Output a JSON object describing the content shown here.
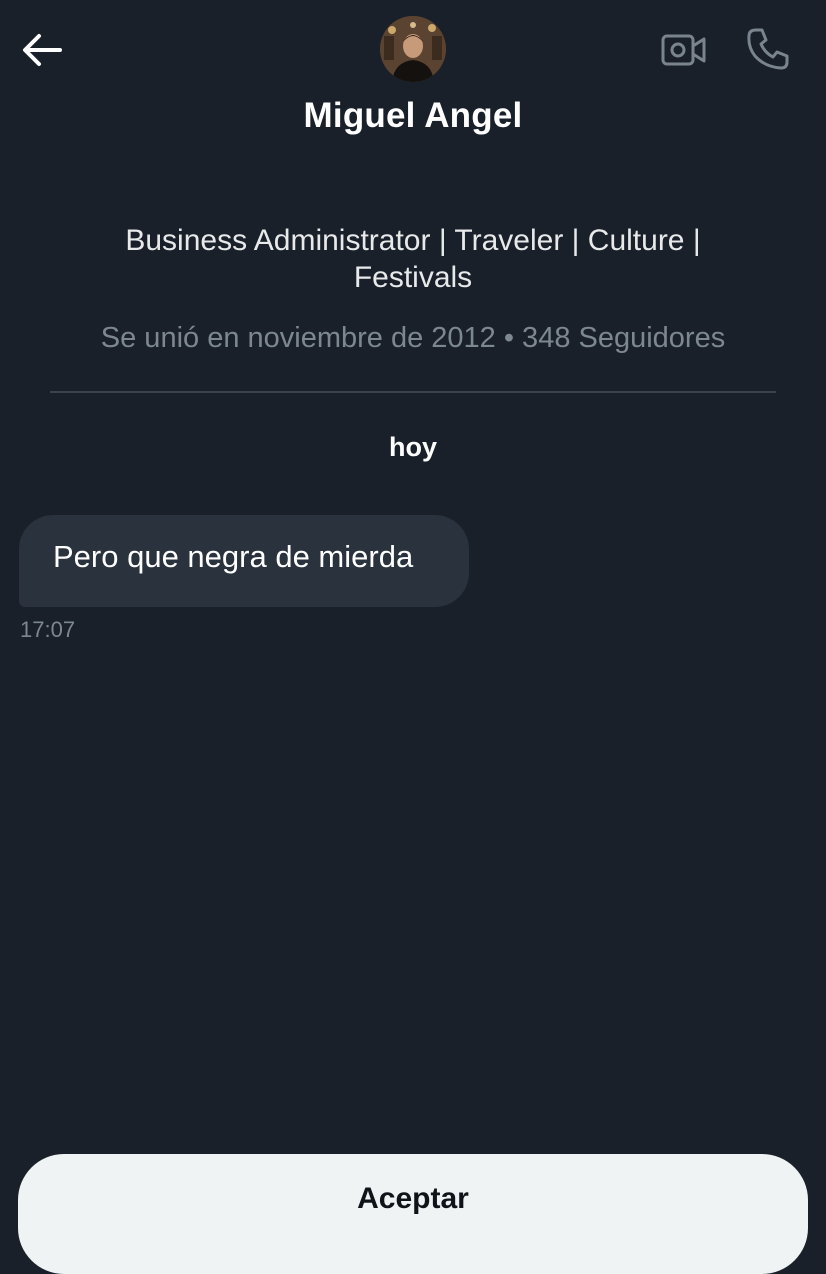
{
  "header": {
    "back_icon": "arrow-left-icon",
    "video_icon": "video-camera-icon",
    "call_icon": "phone-icon",
    "avatar": "profile-photo"
  },
  "profile": {
    "name": "Miguel Angel",
    "bio": "Business Administrator | Traveler | Culture | Festivals",
    "meta": "Se unió en noviembre de 2012 • 348 Seguidores"
  },
  "conversation": {
    "date_label": "hoy",
    "messages": [
      {
        "text": "Pero que negra de mierda",
        "time": "17:07"
      }
    ]
  },
  "actions": {
    "accept_label": "Aceptar"
  },
  "colors": {
    "background": "#19202a",
    "bubble": "#29323d",
    "muted_text": "#7d8790",
    "icon_gray": "#7a848e",
    "button_bg": "#eff3f4"
  }
}
